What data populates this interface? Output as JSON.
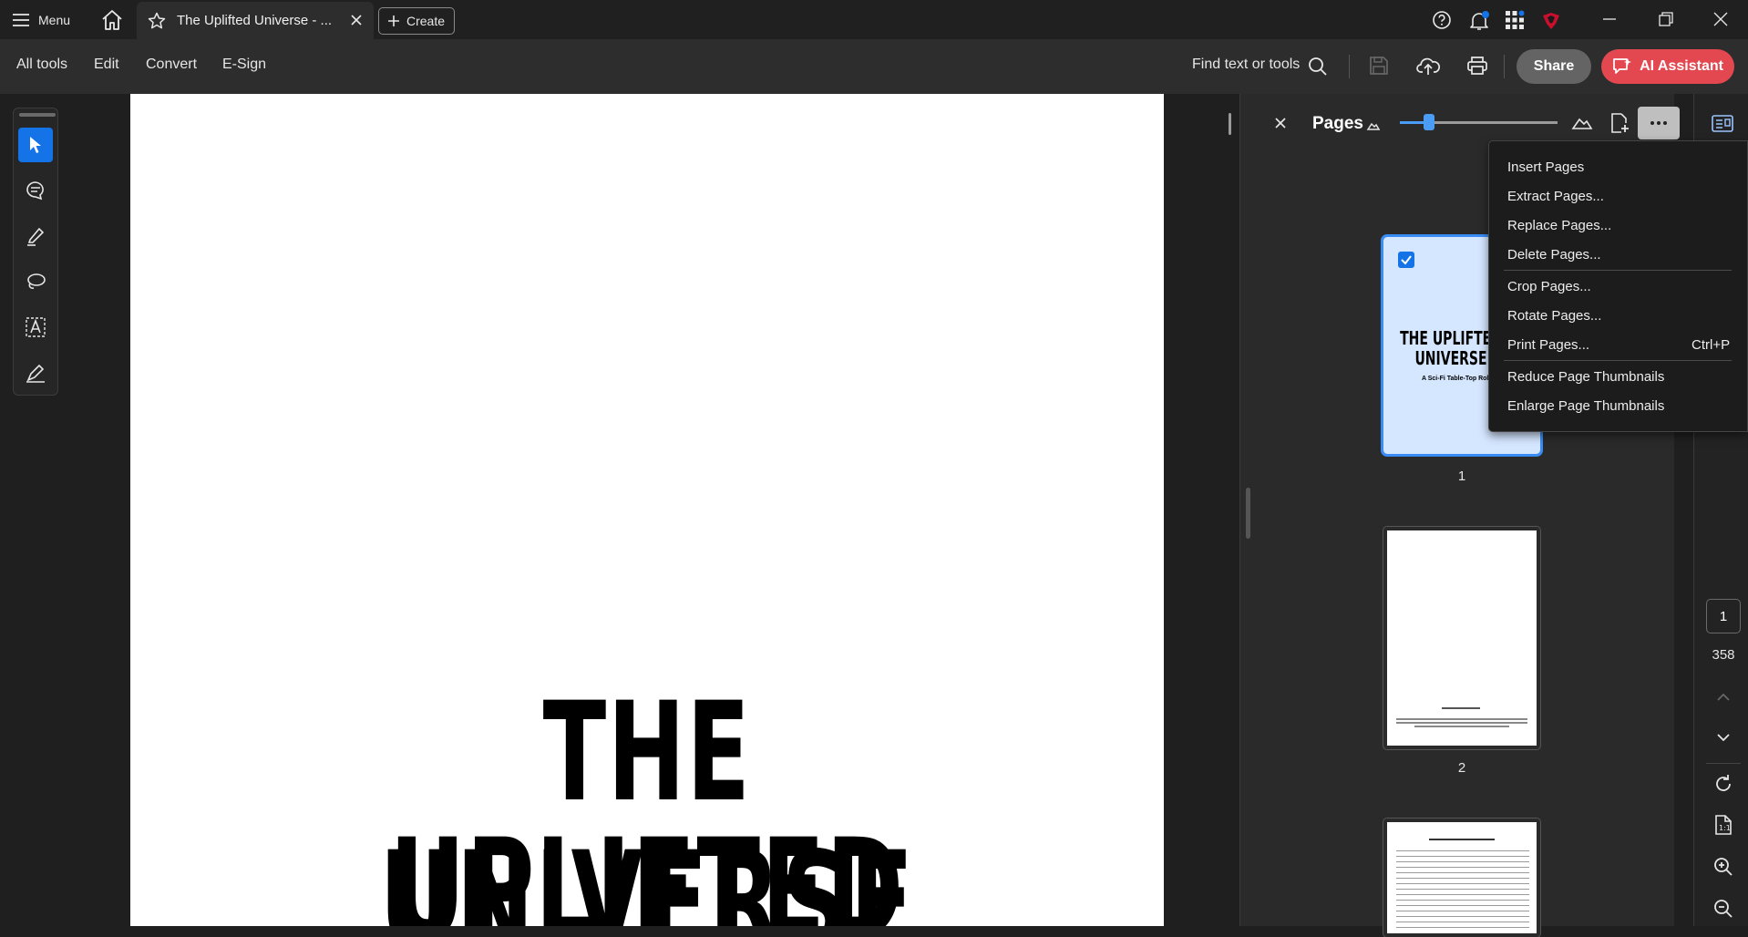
{
  "titlebar": {
    "menu_label": "Menu",
    "tab_title": "The Uplifted Universe - ...",
    "create_label": "Create"
  },
  "toolbar": {
    "all_tools": "All tools",
    "edit": "Edit",
    "convert": "Convert",
    "esign": "E-Sign",
    "find_label": "Find text or tools",
    "share_label": "Share",
    "ai_label": "AI Assistant"
  },
  "document": {
    "title_line1": "THE UPLIFTED",
    "title_line2": "UNIVERSE"
  },
  "pages_panel": {
    "title": "Pages",
    "thumb1_title": "THE UPLIFTED UNIVERSE",
    "thumb1_sub": "A Sci-Fi Table-Top Roleplaying",
    "page_numbers": [
      "1",
      "2"
    ]
  },
  "navigation": {
    "current_page": "1",
    "total_pages": "358"
  },
  "page_menu": {
    "items": [
      {
        "label": "Insert Pages"
      },
      {
        "label": "Extract Pages..."
      },
      {
        "label": "Replace Pages..."
      },
      {
        "label": "Delete Pages..."
      },
      {
        "label": "Crop Pages..."
      },
      {
        "label": "Rotate Pages..."
      },
      {
        "label": "Print Pages...",
        "shortcut": "Ctrl+P"
      },
      {
        "label": "Reduce Page Thumbnails"
      },
      {
        "label": "Enlarge Page Thumbnails"
      }
    ]
  },
  "colors": {
    "accent": "#1473e6",
    "ai_button": "#e34850",
    "selection": "#3a8cf5"
  }
}
